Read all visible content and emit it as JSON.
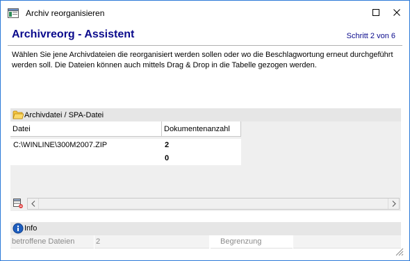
{
  "window": {
    "title": "Archiv reorganisieren",
    "maximize_icon": "maximize-icon",
    "close_icon": "close-icon"
  },
  "header": {
    "title": "Archivreorg - Assistent",
    "step": "Schritt 2 von 6"
  },
  "description": "Wählen Sie jene Archivdateien die reorganisiert werden sollen oder wo die Beschlagwortung erneut durchgeführt werden soll. Die Dateien können auch mittels Drag & Drop in die Tabelle gezogen werden.",
  "archive_panel": {
    "title": "Archivdatei / SPA-Datei",
    "columns": [
      "Datei",
      "Dokumentenanzahl"
    ],
    "rows": [
      {
        "file": "C:\\WINLINE\\300M2007.ZIP",
        "count": "2"
      },
      {
        "file": "",
        "count": "0"
      }
    ]
  },
  "info_panel": {
    "title": "Info",
    "affected_label": "betroffene Dateien",
    "affected_value": "2",
    "limit_label": "Begrenzung",
    "limit_value": ""
  },
  "colors": {
    "heading": "#0a0a8c",
    "window_border": "#2b79d8",
    "panel_header": "#e6e6e6"
  }
}
